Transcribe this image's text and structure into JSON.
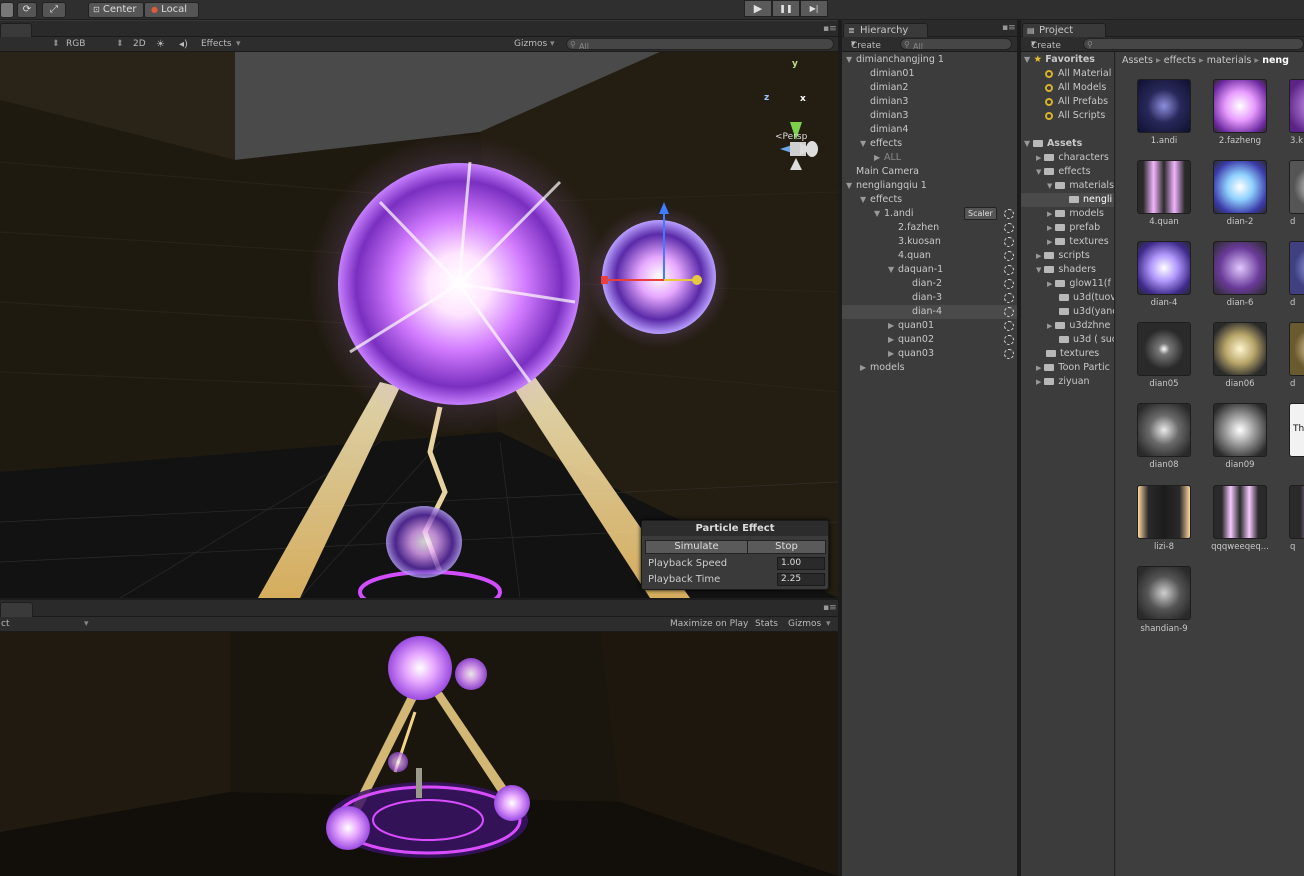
{
  "toolbar": {
    "center_label": "Center",
    "local_label": "Local",
    "play_icon": "▶",
    "pause_icon": "❚❚",
    "step_icon": "▶|"
  },
  "scene": {
    "shading_mode": "RGB",
    "mode_2d": "2D",
    "effects_label": "Effects",
    "gizmos_label": "Gizmos",
    "search_placeholder": "All",
    "persp_label": "Persp",
    "axis_y": "y",
    "axis_x": "x",
    "axis_z": "z"
  },
  "particle_effect": {
    "title": "Particle Effect",
    "simulate_label": "Simulate",
    "stop_label": "Stop",
    "playback_speed_label": "Playback Speed",
    "playback_speed_value": "1.00",
    "playback_time_label": "Playback Time",
    "playback_time_value": "2.25"
  },
  "game": {
    "aspect_label": "ct",
    "maximize_label": "Maximize on Play",
    "stats_label": "Stats",
    "gizmos_label": "Gizmos"
  },
  "hierarchy": {
    "tab_label": "Hierarchy",
    "create_label": "Create",
    "search_placeholder": "All",
    "scaler_label": "Scaler",
    "items": [
      {
        "label": "dimianchangjing 1",
        "arrow": "▼"
      },
      {
        "label": "dimian01",
        "arrow": ""
      },
      {
        "label": "dimian2",
        "arrow": ""
      },
      {
        "label": "dimian3",
        "arrow": ""
      },
      {
        "label": "dimian3",
        "arrow": ""
      },
      {
        "label": "dimian4",
        "arrow": ""
      },
      {
        "label": "effects",
        "arrow": "▼"
      },
      {
        "label": "ALL",
        "arrow": "▶"
      },
      {
        "label": "Main Camera",
        "arrow": ""
      },
      {
        "label": "nengliangqiu 1",
        "arrow": "▼"
      },
      {
        "label": "effects",
        "arrow": "▼"
      },
      {
        "label": "1.andi",
        "arrow": "▼"
      },
      {
        "label": "2.fazhen",
        "arrow": ""
      },
      {
        "label": "3.kuosan",
        "arrow": ""
      },
      {
        "label": "4.quan",
        "arrow": ""
      },
      {
        "label": "daquan-1",
        "arrow": "▼"
      },
      {
        "label": "dian-2",
        "arrow": ""
      },
      {
        "label": "dian-3",
        "arrow": ""
      },
      {
        "label": "dian-4",
        "arrow": ""
      },
      {
        "label": "quan01",
        "arrow": "▶"
      },
      {
        "label": "quan02",
        "arrow": "▶"
      },
      {
        "label": "quan03",
        "arrow": "▶"
      },
      {
        "label": "models",
        "arrow": "▶"
      }
    ]
  },
  "project": {
    "tab_label": "Project",
    "create_label": "Create",
    "breadcrumb": [
      "Assets",
      "effects",
      "materials",
      "neng"
    ],
    "breadcrumb_sep": "▸",
    "favorites_label": "Favorites",
    "favorites": [
      "All Material",
      "All Models",
      "All Prefabs",
      "All Scripts"
    ],
    "assets_label": "Assets",
    "tree": [
      {
        "label": "characters",
        "arrow": "▶"
      },
      {
        "label": "effects",
        "arrow": "▼"
      },
      {
        "label": "materials",
        "arrow": "▼"
      },
      {
        "label": "nengli",
        "arrow": ""
      },
      {
        "label": "models",
        "arrow": "▶"
      },
      {
        "label": "prefab",
        "arrow": "▶"
      },
      {
        "label": "textures",
        "arrow": "▶"
      },
      {
        "label": "scripts",
        "arrow": "▶"
      },
      {
        "label": "shaders",
        "arrow": "▼"
      },
      {
        "label": "glow11(f",
        "arrow": "▶"
      },
      {
        "label": "u3d(tuov",
        "arrow": ""
      },
      {
        "label": "u3d(yanc",
        "arrow": ""
      },
      {
        "label": "u3dzhne",
        "arrow": "▶"
      },
      {
        "label": "u3d ( suc",
        "arrow": ""
      },
      {
        "label": "textures",
        "arrow": ""
      },
      {
        "label": "Toon Partic",
        "arrow": "▶"
      },
      {
        "label": "ziyuan",
        "arrow": "▶"
      }
    ],
    "assets": [
      "1.andi",
      "2.fazheng",
      "3.k",
      "4.quan",
      "dian-2",
      "d",
      "dian-4",
      "dian-6",
      "d",
      "dian05",
      "dian06",
      "d",
      "dian08",
      "dian09",
      "Th or",
      "lizi-8",
      "qqqweeqeq...",
      "q",
      "shandian-9"
    ]
  },
  "colors": {
    "accent_purple": "#b25cff",
    "favorites_star": "#e9c12a",
    "selection": "#4a4a4a"
  }
}
